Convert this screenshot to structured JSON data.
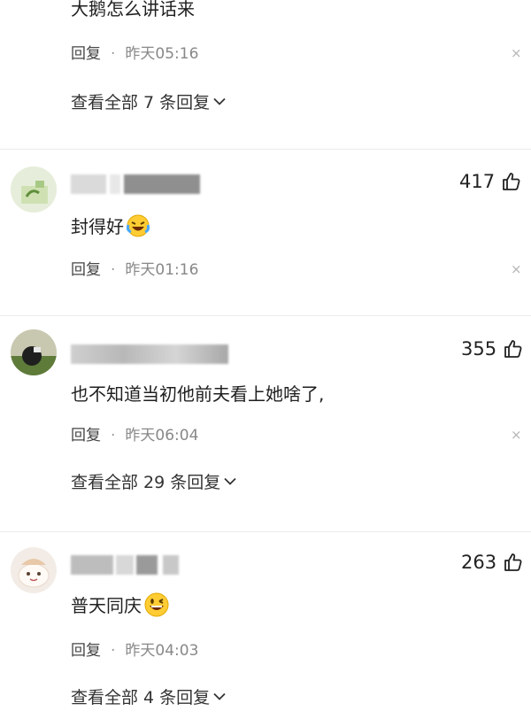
{
  "top_comment": {
    "text": "大鹅怎么讲话来",
    "reply_label": "回复",
    "separator": "·",
    "time": "昨天05:16",
    "close": "×",
    "view_replies": "查看全部 7 条回复"
  },
  "comments": [
    {
      "text": "封得好",
      "emoji": "laughing-crying",
      "likes": "417",
      "reply_label": "回复",
      "separator": "·",
      "time": "昨天01:16",
      "close": "×"
    },
    {
      "text": "也不知道当初他前夫看上她啥了,",
      "likes": "355",
      "reply_label": "回复",
      "separator": "·",
      "time": "昨天06:04",
      "close": "×",
      "view_replies": "查看全部 29 条回复"
    },
    {
      "text": "普天同庆",
      "emoji": "grinning-face",
      "likes": "263",
      "reply_label": "回复",
      "separator": "·",
      "time": "昨天04:03",
      "view_replies": "查看全部 4 条回复"
    }
  ]
}
